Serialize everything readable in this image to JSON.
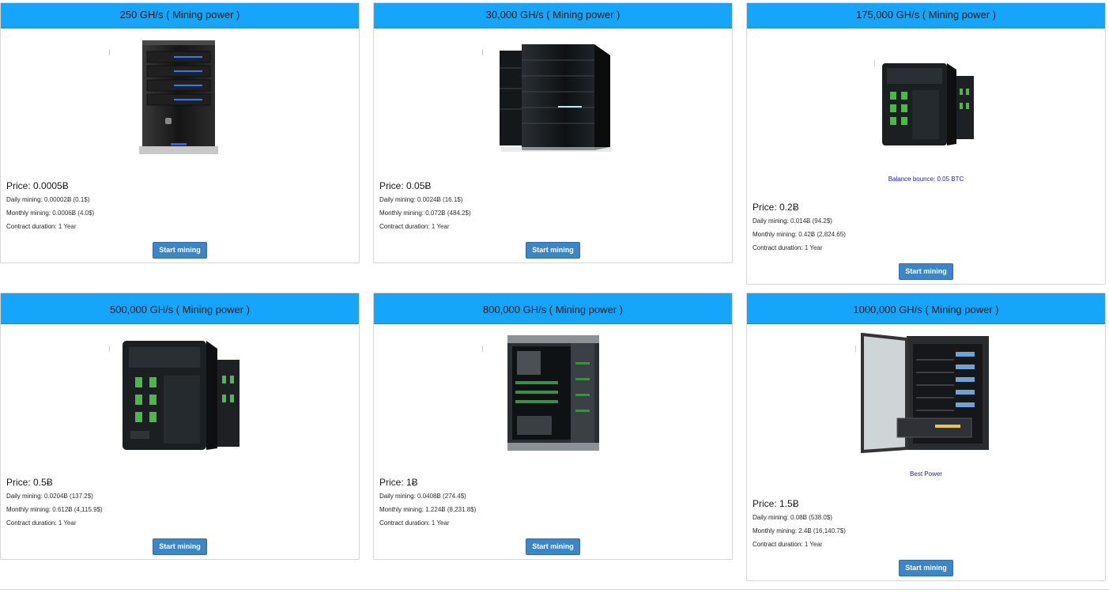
{
  "plans": [
    {
      "header": "250 GH/s ( Mining power )",
      "price": "Price: 0.0005Ƀ",
      "daily_label": "Daily mining:",
      "daily_value": " 0.00002Ƀ (0.1$)",
      "monthly_label": "Monthly mining:",
      "monthly_value": " 0.0006Ƀ (4.0$)",
      "duration_label": "Contract duration:",
      "duration_value": " 1 Year",
      "promo": "",
      "button": "Start mining"
    },
    {
      "header": "30,000 GH/s ( Mining power )",
      "price": "Price: 0.05Ƀ",
      "daily_label": "Daily mining:",
      "daily_value": " 0.0024Ƀ (16.1$)",
      "monthly_label": "Monthly mining:",
      "monthly_value": " 0.072Ƀ (484.2$)",
      "duration_label": "Contract duration:",
      "duration_value": " 1 Year",
      "promo": "",
      "button": "Start mining"
    },
    {
      "header": "175,000 GH/s ( Mining power )",
      "price": "Price: 0.2Ƀ",
      "daily_label": "Daily mining:",
      "daily_value": " 0.014Ƀ (94.2$)",
      "monthly_label": "Monthly mining:",
      "monthly_value": " 0.42Ƀ (2,824.65)",
      "duration_label": "Contract duration:",
      "duration_value": " 1 Year",
      "promo": "Balance bounce: 0.05 BTC",
      "button": "Start mining"
    },
    {
      "header": "500,000 GH/s ( Mining power )",
      "price": "Price: 0.5Ƀ",
      "daily_label": "Daily mining:",
      "daily_value": " 0.0204Ƀ (137.2$)",
      "monthly_label": "Monthly mining:",
      "monthly_value": " 0.612Ƀ (4,115.9$)",
      "duration_label": "Contract duration:",
      "duration_value": " 1 Year",
      "promo": "",
      "button": "Start mining"
    },
    {
      "header": "800,000 GH/s ( Mining power )",
      "price": "Price: 1Ƀ",
      "daily_label": "Daily mining:",
      "daily_value": " 0.0408Ƀ (274.4$)",
      "monthly_label": "Monthly mining:",
      "monthly_value": " 1.224Ƀ (8,231.8$)",
      "duration_label": "Contract duration:",
      "duration_value": " 1 Year",
      "promo": "",
      "button": "Start mining"
    },
    {
      "header": "1000,000 GH/s ( Mining power )",
      "price": "Price: 1.5Ƀ",
      "daily_label": "Daily mining:",
      "daily_value": " 0.08Ƀ (538.0$)",
      "monthly_label": "Monthly mining:",
      "monthly_value": " 2.4Ƀ (16,140.7$)",
      "duration_label": "Contract duration:",
      "duration_value": " 1 Year",
      "promo": "Best Power",
      "button": "Start mining"
    }
  ],
  "colors": {
    "header_bg": "#15a5fb",
    "button_bg": "#3a86c8",
    "promo_text": "#1f23d1"
  },
  "icons": [
    "server-tower-icon",
    "server-cabinet-icon",
    "mining-rig-icon",
    "open-case-icon",
    "rack-cabinet-icon"
  ]
}
